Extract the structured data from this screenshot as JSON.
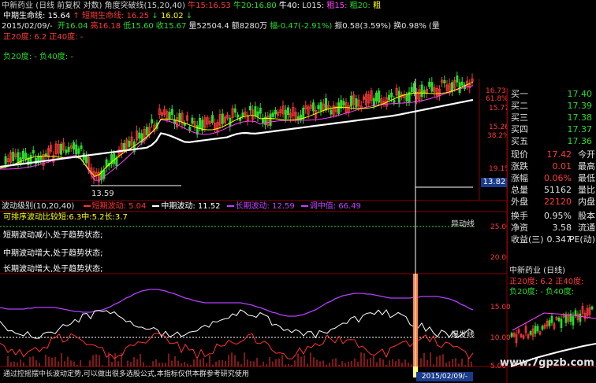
{
  "header": {
    "stock_name": "中新药业",
    "period_tag": "(日线 前复权 对数)",
    "indicator_name": "角度突破线(15,20,40)",
    "ma_items": [
      {
        "label": "牛15:",
        "value": "16.53",
        "color": "#ff3a3a"
      },
      {
        "label": "牛20:",
        "value": "16.80",
        "color": "#2bdc2b"
      },
      {
        "label": "牛40:",
        "value": "",
        "color": "#ffffff"
      },
      {
        "label": "L015:",
        "value": "",
        "color": "#e0e0e0"
      },
      {
        "label": "粗15:",
        "value": "",
        "color": "#ff40ff"
      },
      {
        "label": "粗20:",
        "value": "",
        "color": "#2bdc2b"
      },
      {
        "label": "粗",
        "value": "",
        "color": "#ffff00"
      }
    ],
    "life_line_mid_label": "中期生命线:",
    "life_line_mid_value": "15.64",
    "life_line_short_label": "短期生命线:",
    "life_line_short_value": "16.25",
    "life_line_short_value2": "16.02",
    "date": "2015/02/09/-",
    "ohlc": [
      {
        "label": "开",
        "value": "16.04",
        "color": "#2bdc2b"
      },
      {
        "label": "高",
        "value": "16.18",
        "color": "#ff3a3a"
      },
      {
        "label": "低",
        "value": "15.60",
        "color": "#2bdc2b"
      },
      {
        "label": "收",
        "value": "15.67",
        "color": "#2bdc2b"
      },
      {
        "label": "量",
        "value": "52504.4",
        "color": "#e0e0e0"
      },
      {
        "label": "额",
        "value": "8280万",
        "color": "#e0e0e0"
      },
      {
        "label": "幅",
        "value": "-0.47(-2.91%)",
        "color": "#2bdc2b"
      },
      {
        "label": "振",
        "value": "0.58(3.59%)",
        "color": "#e0e0e0"
      },
      {
        "label": "换",
        "value": "0.98%",
        "color": "#e0e0e0"
      },
      {
        "label": "",
        "value": "(量",
        "color": "#e0e0e0"
      }
    ],
    "plus_line": "正20度: 6.2  正40度: -",
    "minus_line": "负20度: -  负40度: -"
  },
  "main_chart": {
    "price_labels": [
      "16.73",
      "61.8%",
      "15.77",
      "15.26",
      "38.2%",
      "19.1%"
    ],
    "low_marker": "13.59",
    "cursor_price": "13.82"
  },
  "sub_chart": {
    "title": "波动级别(10,20,40)",
    "legend": [
      {
        "label": "短期波动:",
        "value": "5.04",
        "color": "#ff3030"
      },
      {
        "label": "中期波动:",
        "value": "11.52",
        "color": "#ffffff"
      },
      {
        "label": "长期波动:",
        "value": "12.59",
        "color": "#c040ff"
      },
      {
        "label": "调中值:",
        "value": "66.49",
        "color": "#c040ff"
      }
    ],
    "ratio_line": "可排序波动比较短:6.3中:5.2长:3.7",
    "notes": [
      "短期波动减小,处于趋势状态;",
      "中期波动增大,处于趋势状态;",
      "长期波动增大,处于趋势状态;"
    ],
    "y_labels": [
      "25.00",
      "20.00",
      "15.00",
      "10.00",
      "5.00"
    ],
    "tag_abnormal": "异动线",
    "tag_burst": "爆发线",
    "cursor_date": "2015/02/09/-",
    "footer": "通过控摇摆中长波动定势,可以做出很多选股公式,本指标仅供本群参考研究使用"
  },
  "quote": {
    "rows": [
      {
        "label": "买一",
        "value": "17.40",
        "color": "#2bdc2b"
      },
      {
        "label": "买二",
        "value": "17.39",
        "color": "#2bdc2b"
      },
      {
        "label": "买三",
        "value": "17.38",
        "color": "#2bdc2b"
      },
      {
        "label": "买四",
        "value": "17.37",
        "color": "#2bdc2b"
      },
      {
        "label": "买五",
        "value": "17.36",
        "color": "#2bdc2b"
      }
    ],
    "stats": [
      {
        "l1": "现价",
        "v1": "17.42",
        "c1": "#ff3a3a",
        "l2": "今开"
      },
      {
        "l1": "涨跌",
        "v1": "0.01",
        "c1": "#ff3a3a",
        "l2": "最高"
      },
      {
        "l1": "涨幅",
        "v1": "0.06%",
        "c1": "#ff3a3a",
        "l2": "最低"
      },
      {
        "l1": "总量",
        "v1": "51162",
        "c1": "#e0e0e0",
        "l2": "量比"
      },
      {
        "l1": "外盘",
        "v1": "22120",
        "c1": "#ff3a3a",
        "l2": "内盘"
      }
    ],
    "stats2": [
      {
        "l1": "换手",
        "v1": "0.95%",
        "c1": "#e0e0e0",
        "l2": "股本"
      },
      {
        "l1": "净资",
        "v1": "3.58",
        "c1": "#e0e0e0",
        "l2": "流通"
      },
      {
        "l1": "收益(三)",
        "v1": "0.347",
        "c1": "#e0e0e0",
        "l2": "PE(动)"
      }
    ]
  },
  "mini_chart": {
    "title": "中新药业 (日线)",
    "plus_line": "正20度: 6.2  正40度:",
    "minus_line": "负20度: -  负40度:"
  },
  "watermark": "www.7gpzb.com",
  "colors": {
    "up": "#ff3a3a",
    "down": "#2bdc2b",
    "bg": "#000000",
    "grid": "#8a0000"
  }
}
